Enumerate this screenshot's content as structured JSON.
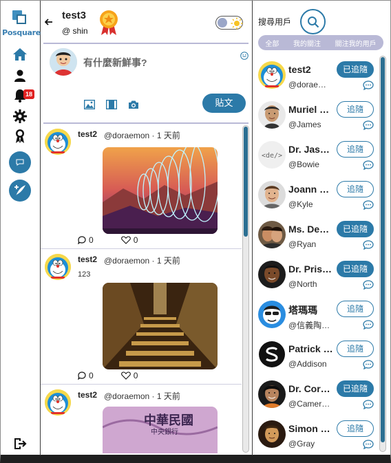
{
  "app": {
    "logo_text": "Posquare",
    "notification_count": "18"
  },
  "profile": {
    "name": "test3",
    "handle": "@ shin"
  },
  "compose": {
    "placeholder": "有什麼新鮮事?",
    "post_label": "貼文"
  },
  "posts": [
    {
      "author": "test2",
      "meta": "@doraemon · 1 天前",
      "text": "",
      "replies": "0",
      "likes": "0",
      "image": "spiral-art"
    },
    {
      "author": "test2",
      "meta": "@doraemon · 1 天前",
      "text": "123",
      "replies": "0",
      "likes": "0",
      "image": "stairs"
    },
    {
      "author": "test2",
      "meta": "@doraemon · 1 天前",
      "text": "",
      "replies": "",
      "likes": "",
      "image": "banknote",
      "banknote_text": "中華民國",
      "banknote_subtext": "中央銀行"
    }
  ],
  "search": {
    "label": "搜尋用戶"
  },
  "filters": [
    "全部",
    "我的關注",
    "關注我的用戶"
  ],
  "users": [
    {
      "name": "test2",
      "handle": "@dorae…",
      "follow": "已追隨",
      "following": true,
      "avatar": "doraemon"
    },
    {
      "name": "Muriel …",
      "handle": "@James",
      "follow": "追隨",
      "following": false,
      "avatar": "person1"
    },
    {
      "name": "Dr. Jas…",
      "handle": "@Bowie",
      "follow": "追隨",
      "following": false,
      "avatar": "code"
    },
    {
      "name": "Joann …",
      "handle": "@Kyle",
      "follow": "追隨",
      "following": false,
      "avatar": "person2"
    },
    {
      "name": "Ms. De…",
      "handle": "@Ryan",
      "follow": "已追隨",
      "following": true,
      "avatar": "person3"
    },
    {
      "name": "Dr. Pris…",
      "handle": "@North",
      "follow": "已追隨",
      "following": true,
      "avatar": "person4"
    },
    {
      "name": "塔瑪瑪",
      "handle": "@信義陶…",
      "follow": "追隨",
      "following": false,
      "avatar": "cartoon"
    },
    {
      "name": "Patrick …",
      "handle": "@Addison",
      "follow": "追隨",
      "following": false,
      "avatar": "logo"
    },
    {
      "name": "Dr. Cor…",
      "handle": "@Camer…",
      "follow": "已追隨",
      "following": true,
      "avatar": "person5"
    },
    {
      "name": "Simon …",
      "handle": "@Gray",
      "follow": "追隨",
      "following": false,
      "avatar": "person6"
    }
  ]
}
